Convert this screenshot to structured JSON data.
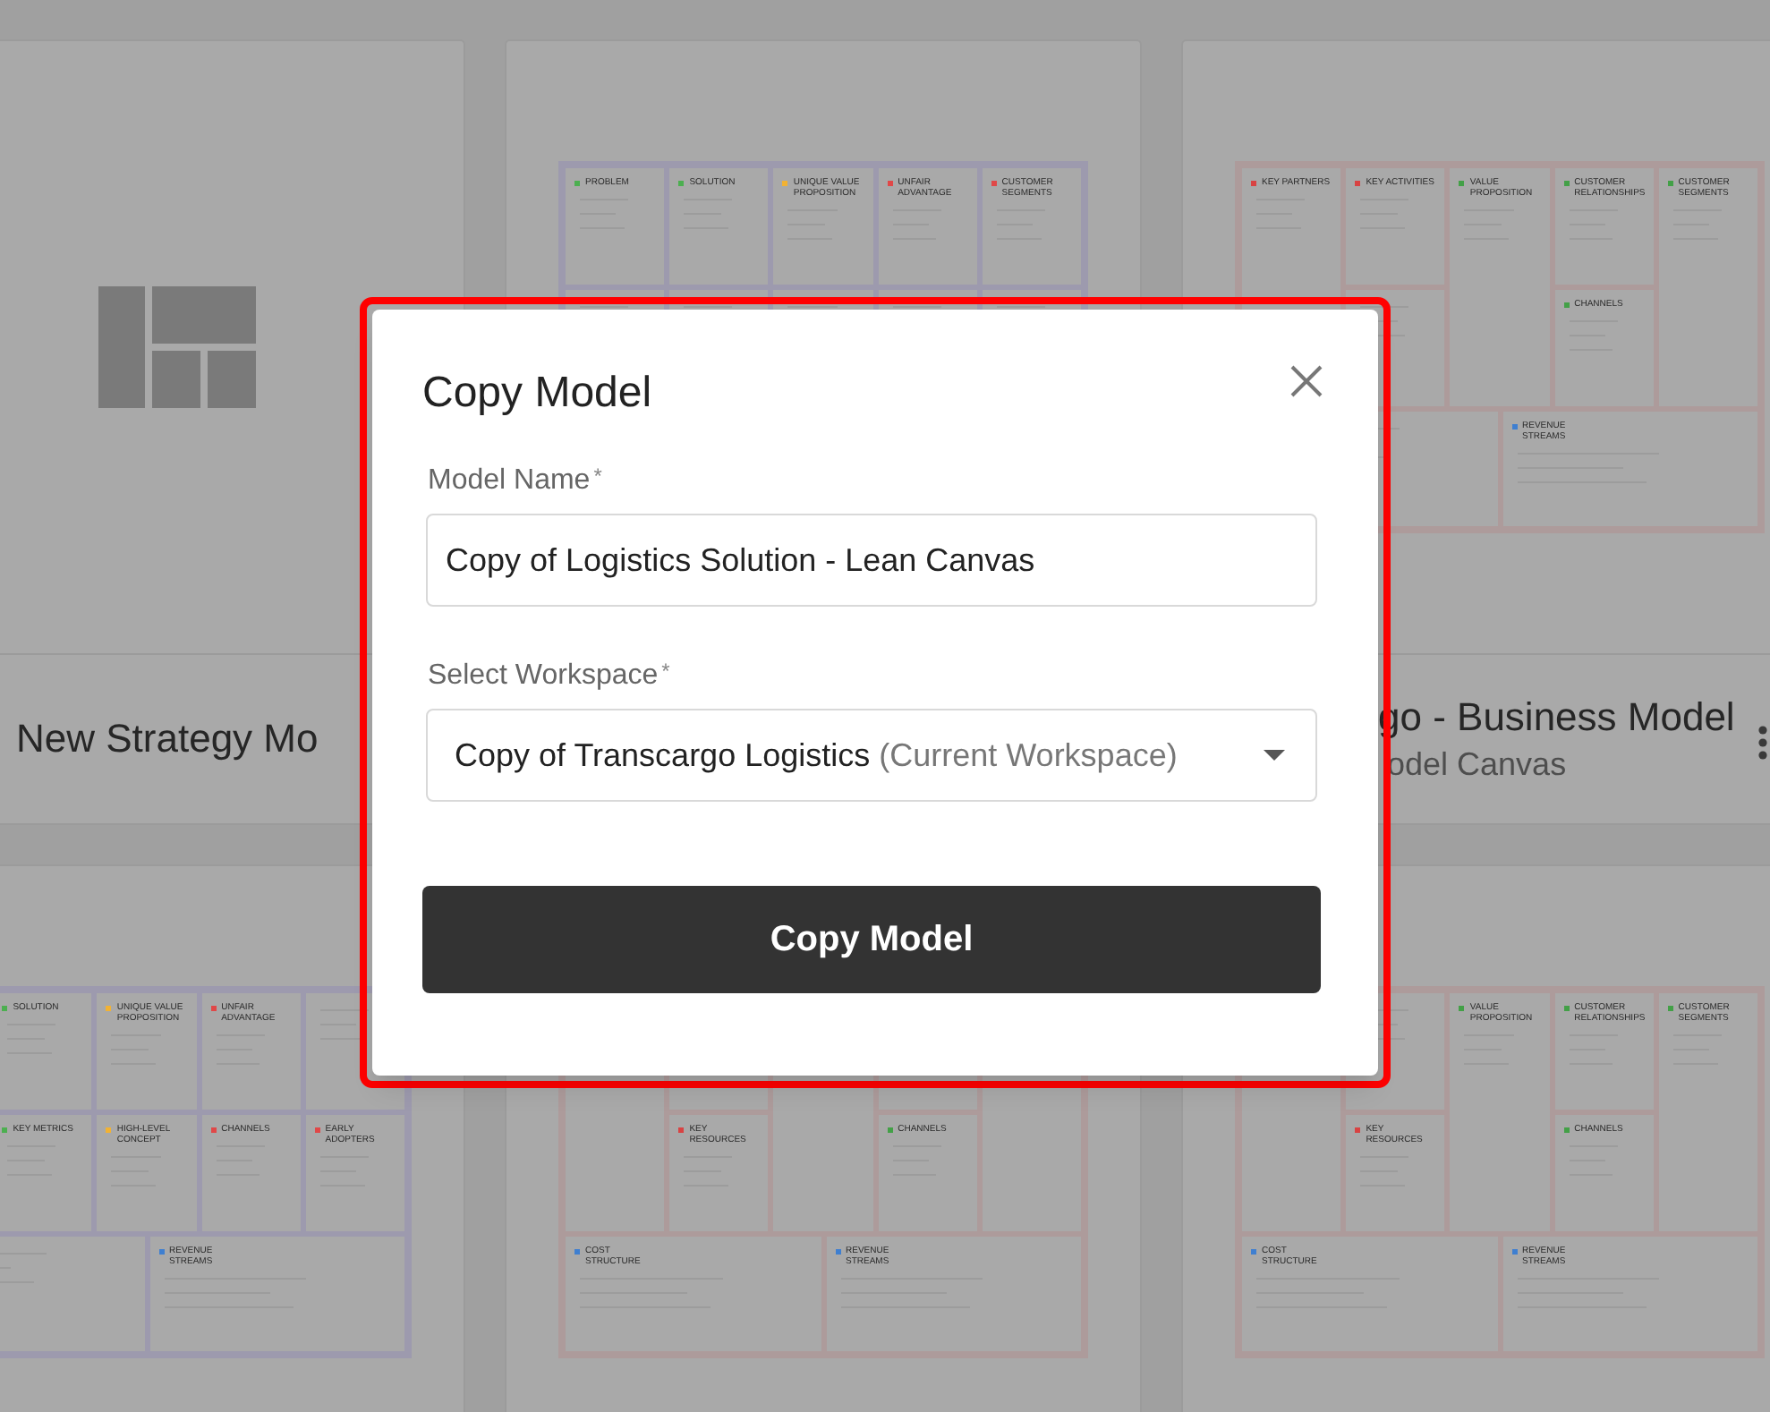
{
  "cards": [
    {
      "kind": "blank",
      "title": "New Strategy Mo"
    },
    {
      "kind": "lean",
      "blocks": [
        {
          "kind": "problem",
          "label": "PROBLEM",
          "color": "#4caf50"
        },
        {
          "kind": "solution",
          "label": "SOLUTION",
          "color": "#4caf50"
        },
        {
          "kind": "uvp",
          "label": "UNIQUE VALUE PROPOSITION",
          "color": "#f2b233"
        },
        {
          "kind": "unfair",
          "label": "UNFAIR ADVANTAGE",
          "color": "#e04848"
        },
        {
          "kind": "segments",
          "label": "CUSTOMER SEGMENTS",
          "color": "#e04848"
        }
      ]
    },
    {
      "kind": "bmc",
      "title": "go - Business Model",
      "subtitle": "odel Canvas",
      "blocks": [
        {
          "kind": "partners",
          "label": "KEY PARTNERS",
          "color": "#d84343"
        },
        {
          "kind": "activities",
          "label": "KEY ACTIVITIES",
          "color": "#d84343"
        },
        {
          "kind": "value",
          "label": "VALUE PROPOSITION",
          "color": "#43a047"
        },
        {
          "kind": "relationships",
          "label": "CUSTOMER RELATIONSHIPS",
          "color": "#43a047"
        },
        {
          "kind": "channels",
          "label": "CHANNELS",
          "color": "#43a047"
        },
        {
          "kind": "segments",
          "label": "CUSTOMER SEGMENTS",
          "color": "#43a047"
        },
        {
          "kind": "revenue",
          "label": "REVENUE STREAMS",
          "color": "#3f7fd0"
        }
      ]
    },
    {
      "kind": "lean",
      "blocks": [
        {
          "kind": "solution",
          "label": "SOLUTION",
          "color": "#4caf50"
        },
        {
          "kind": "uvp",
          "label": "UNIQUE VALUE PROPOSITION",
          "color": "#f2b233"
        },
        {
          "kind": "unfair",
          "label": "UNFAIR ADVANTAGE",
          "color": "#e04848"
        },
        {
          "kind": "metrics",
          "label": "KEY METRICS",
          "color": "#4caf50"
        },
        {
          "kind": "concept",
          "label": "HIGH-LEVEL CONCEPT",
          "color": "#f2b233"
        },
        {
          "kind": "channels",
          "label": "CHANNELS",
          "color": "#e04848"
        },
        {
          "kind": "adopters",
          "label": "EARLY ADOPTERS",
          "color": "#e04848"
        },
        {
          "kind": "revenue",
          "label": "REVENUE STREAMS",
          "color": "#3f7fd0"
        }
      ]
    },
    {
      "kind": "bmc",
      "blocks": [
        {
          "kind": "resources",
          "label": "KEY RESOURCES",
          "color": "#d84343"
        },
        {
          "kind": "channels",
          "label": "CHANNELS",
          "color": "#43a047"
        },
        {
          "kind": "cost",
          "label": "COST STRUCTURE",
          "color": "#3f7fd0"
        },
        {
          "kind": "revenue",
          "label": "REVENUE STREAMS",
          "color": "#3f7fd0"
        }
      ]
    },
    {
      "kind": "bmc",
      "blocks": [
        {
          "kind": "resources",
          "label": "KEY RESOURCES",
          "color": "#d84343"
        },
        {
          "kind": "value",
          "label": "VALUE PROPOSITION",
          "color": "#43a047"
        },
        {
          "kind": "relationships",
          "label": "CUSTOMER RELATIONSHIPS",
          "color": "#43a047"
        },
        {
          "kind": "channels",
          "label": "CHANNELS",
          "color": "#43a047"
        },
        {
          "kind": "segments",
          "label": "CUSTOMER SEGMENTS",
          "color": "#43a047"
        },
        {
          "kind": "cost",
          "label": "COST STRUCTURE",
          "color": "#3f7fd0"
        },
        {
          "kind": "revenue",
          "label": "REVENUE STREAMS",
          "color": "#3f7fd0"
        }
      ]
    }
  ],
  "dialog": {
    "title": "Copy Model",
    "fields": [
      {
        "kind": "text",
        "label": "Model Name",
        "required_mark": "*",
        "value": "Copy of Logistics Solution - Lean Canvas"
      },
      {
        "kind": "select",
        "label": "Select Workspace",
        "required_mark": "*",
        "value": "Copy of Transcargo Logistics",
        "note": "(Current Workspace)"
      }
    ],
    "button": "Copy Model"
  }
}
